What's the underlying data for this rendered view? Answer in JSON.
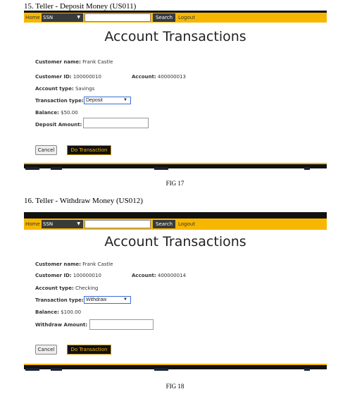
{
  "sections": [
    {
      "heading": "15. Teller - Deposit Money (US011)",
      "caption": "FIG 17",
      "nav": {
        "home": "Home",
        "ssn": "SSN",
        "search_value": "",
        "search": "Search",
        "logout": "Logout"
      },
      "title": "Account Transactions",
      "customer_name_label": "Customer name:",
      "customer_name": "Frank Castle",
      "customer_id_label": "Customer ID:",
      "customer_id": "100000010",
      "account_label": "Account:",
      "account": "400000013",
      "account_type_label": "Account type:",
      "account_type": "Savings",
      "transaction_type_label": "Transaction type:",
      "transaction_type": "Deposit",
      "balance_label": "Balance:",
      "balance": "$50.00",
      "amount_label": "Deposit Amount:",
      "amount_value": "",
      "cancel": "Cancel",
      "do_transaction": "Do Transaction"
    },
    {
      "heading": "16. Teller - Withdraw Money (US012)",
      "caption": "FIG 18",
      "nav": {
        "home": "Home",
        "ssn": "SSN",
        "search_value": "",
        "search": "Search",
        "logout": "Logout"
      },
      "title": "Account Transactions",
      "customer_name_label": "Customer name:",
      "customer_name": "Frank Castle",
      "customer_id_label": "Customer ID:",
      "customer_id": "100000010",
      "account_label": "Account:",
      "account": "400000014",
      "account_type_label": "Account type:",
      "account_type": "Checking",
      "transaction_type_label": "Transaction type:",
      "transaction_type": "Withdraw",
      "balance_label": "Balance:",
      "balance": "$100.00",
      "amount_label": "Withdraw Amount:",
      "amount_value": "",
      "cancel": "Cancel",
      "do_transaction": "Do Transaction"
    }
  ],
  "colors": {
    "nav_bar": "#f7b700",
    "dark": "#111111",
    "button_text": "#f7b700"
  },
  "icons": {
    "select_caret": "caret-down-icon"
  }
}
